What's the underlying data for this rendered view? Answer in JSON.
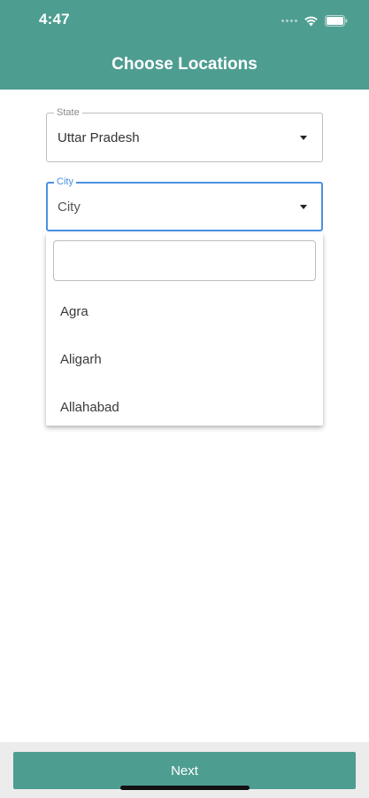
{
  "status_bar": {
    "time": "4:47"
  },
  "header": {
    "title": "Choose Locations"
  },
  "state_field": {
    "label": "State",
    "value": "Uttar Pradesh"
  },
  "city_field": {
    "label": "City",
    "value": "City"
  },
  "dropdown": {
    "search_placeholder": "",
    "items": [
      {
        "label": "Agra"
      },
      {
        "label": "Aligarh"
      },
      {
        "label": "Allahabad"
      }
    ]
  },
  "footer": {
    "next_label": "Next"
  },
  "colors": {
    "primary": "#4e9d91",
    "focus": "#4a90e2"
  },
  "icons": {
    "signal": "cellular-signal-icon",
    "wifi": "wifi-icon",
    "battery": "battery-icon",
    "dropdown": "dropdown-arrow-icon"
  }
}
